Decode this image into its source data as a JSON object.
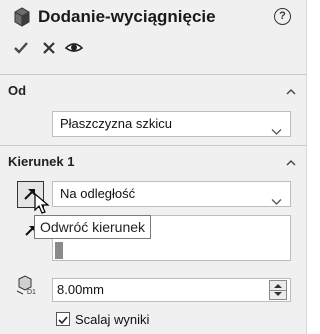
{
  "window": {
    "title": "Dodanie-wyciągnięcie",
    "help_icon": "question-circle-icon",
    "help_glyph": "?"
  },
  "actions": [
    {
      "name": "ok",
      "icon": "checkmark-icon"
    },
    {
      "name": "cancel",
      "icon": "close-icon"
    },
    {
      "name": "preview",
      "icon": "eye-icon"
    }
  ],
  "from_section": {
    "title": "Od",
    "select_value": "Płaszczyzna szkicu"
  },
  "direction1_section": {
    "title": "Kierunek 1",
    "end_condition": "Na odległość",
    "reverse_tooltip": "Odwróć kierunek",
    "depth_value": "8.00mm",
    "merge_label": "Scalaj wyniki",
    "merge_checked": true
  },
  "colors": {
    "panel_bg": "#f0f0f0",
    "check_green": "#4a4a4a"
  }
}
